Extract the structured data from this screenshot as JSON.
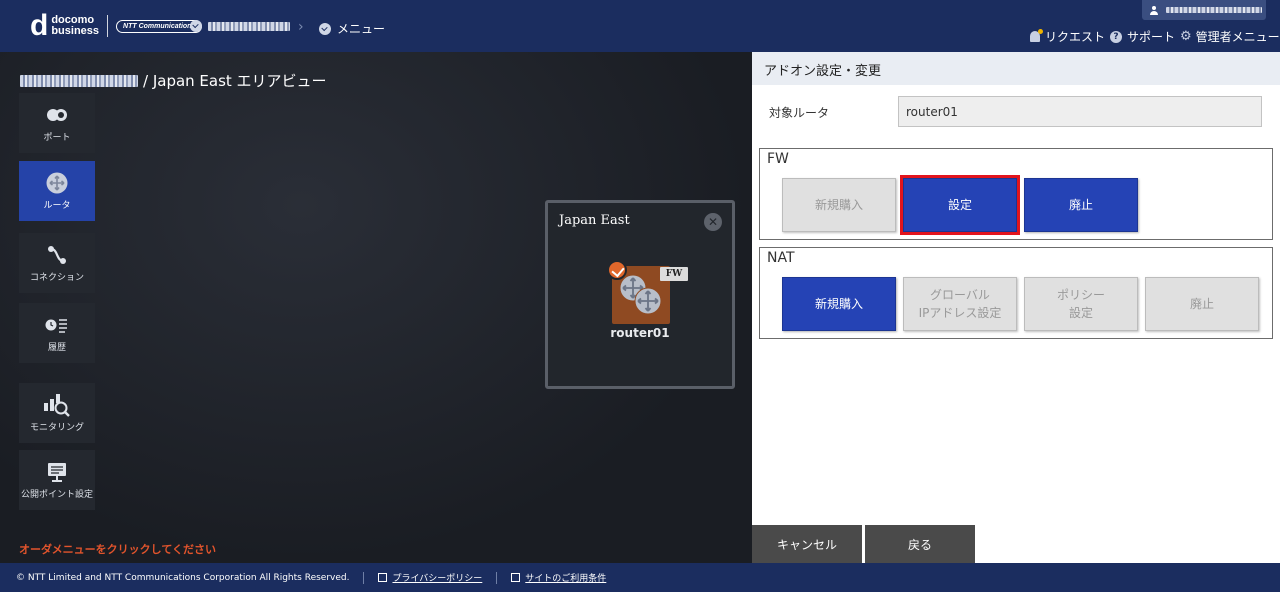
{
  "header": {
    "brand_d": "d",
    "brand_line1": "docomo",
    "brand_line2": "business",
    "ntt_logo": "NTT Communications",
    "menu_crumb": "メニュー",
    "nav": {
      "request": "リクエスト",
      "support": "サポート",
      "admin_menu": "管理者メニュー"
    }
  },
  "page": {
    "title": "/ Japan East エリアビュー"
  },
  "sidebar": {
    "items": [
      {
        "label": "ポート",
        "icon": "port-icon"
      },
      {
        "label": "ルータ",
        "icon": "router-icon",
        "active": true
      },
      {
        "label": "コネクション",
        "icon": "connection-icon"
      },
      {
        "label": "履歴",
        "icon": "history-icon"
      },
      {
        "label": "モニタリング",
        "icon": "monitoring-icon"
      },
      {
        "label": "公開ポイント設定",
        "icon": "public-point-icon"
      }
    ]
  },
  "hint": "オーダメニューをクリックしてください",
  "area_card": {
    "name": "Japan East",
    "close_symbol": "✕",
    "router_name": "router01",
    "fw_tag": "FW"
  },
  "panel": {
    "title": "アドオン設定・変更",
    "target_label": "対象ルータ",
    "target_value": "router01",
    "fw": {
      "title": "FW",
      "new_purchase": "新規購入",
      "settings": "設定",
      "abolish": "廃止"
    },
    "nat": {
      "title": "NAT",
      "new_purchase": "新規購入",
      "global_ip_line1": "グローバル",
      "global_ip_line2": "IPアドレス設定",
      "policy_line1": "ポリシー",
      "policy_line2": "設定",
      "abolish": "廃止"
    },
    "cancel": "キャンセル",
    "back": "戻る"
  },
  "footer": {
    "copyright": "© NTT Limited and NTT Communications Corporation All Rights Reserved.",
    "privacy": "プライバシーポリシー",
    "terms": "サイトのご利用条件"
  },
  "colors": {
    "header_bg": "#1b2d5f",
    "primary_button": "#2543b5",
    "highlight_outline": "#e2141d",
    "hint_text": "#e2542c"
  }
}
